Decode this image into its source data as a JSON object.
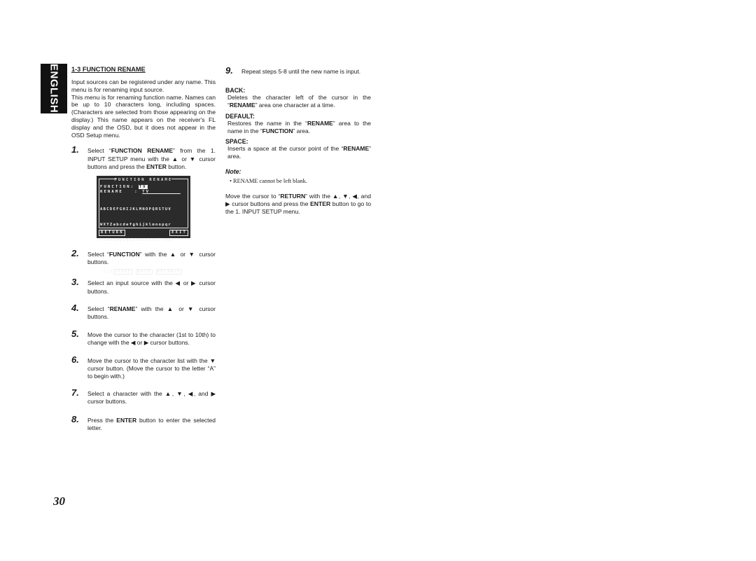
{
  "language_tab": "ENGLISH",
  "section": {
    "title": "1-3  FUNCTION RENAME",
    "intro": [
      "Input sources can be registered under any name. This menu is for renaming input source.",
      "This menu is for renaming function name. Names can be up to 10 characters long, including spaces. (Characters are selected from those appearing on the display.) This name appears on the receiver's FL display and the OSD, but it does not appear in the OSD Setup menu."
    ]
  },
  "steps": [
    {
      "num": "1.",
      "pre": "Select “",
      "bold": "FUNCTION RENAME",
      "post": "” from the 1. INPUT SETUP menu with the ▲ or ▼ cursor buttons and press the ",
      "bold2": "ENTER",
      "post2": " button."
    },
    {
      "num": "2.",
      "pre": "Select “",
      "bold": "FUNCTION",
      "post": "” with the ▲ or ▼ cursor buttons.",
      "bold2": "",
      "post2": ""
    },
    {
      "num": "3.",
      "pre": "Select an input source with the ◀ or ▶ cursor buttons.",
      "bold": "",
      "post": "",
      "bold2": "",
      "post2": ""
    },
    {
      "num": "4.",
      "pre": "Select “",
      "bold": "RENAME",
      "post": "” with the ▲ or ▼ cursor buttons.",
      "bold2": "",
      "post2": ""
    },
    {
      "num": "5.",
      "pre": "Move the cursor to the character (1st to 10th) to change with the ◀ or ▶ cursor buttons.",
      "bold": "",
      "post": "",
      "bold2": "",
      "post2": ""
    },
    {
      "num": "6.",
      "pre": "Move the cursor to the character list with the ▼ cursor button. (Move the cursor to the letter “A” to begin with.)",
      "bold": "",
      "post": "",
      "bold2": "",
      "post2": ""
    },
    {
      "num": "7.",
      "pre": "Select a character with the ▲, ▼, ◀, and ▶ cursor buttons.",
      "bold": "",
      "post": "",
      "bold2": "",
      "post2": ""
    },
    {
      "num": "8.",
      "pre": "Press the ",
      "bold": "ENTER",
      "post": " button to enter the selected letter.",
      "bold2": "",
      "post2": ""
    },
    {
      "num": "9.",
      "pre": "Repeat steps 5-8 until the new name is input.",
      "bold": "",
      "post": "",
      "bold2": "",
      "post2": ""
    }
  ],
  "osd": {
    "title": "FUNCTION RENAME",
    "function_label": "FUNCTION:",
    "function_value": "TV",
    "rename_label": "RENAME   :",
    "rename_value": "TV________",
    "char_rows": [
      "ABCDEFGHIJKLMNOPQRSTUV",
      "WXYZabcdefghijklmnopqr",
      "stuvwxyz0123456789!\"#$",
      "%&'()*+,-./:;<=>?@[\\]^",
      "_{|}"
    ],
    "space_btn": "SPACE",
    "back_btn": "BACK",
    "default_btn": "DEFAULT",
    "return_btn": "RETURN",
    "exit_btn": "EXIT"
  },
  "definitions": [
    {
      "term": "BACK:",
      "pre": "Deletes the character left of the cursor in the “",
      "bold": "RENAME",
      "post": "” area one character at a time.",
      "bold2": "",
      "post2": ""
    },
    {
      "term": "DEFAULT:",
      "pre": "Restores the name in the “",
      "bold": "RENAME",
      "post": "” area to the name in the “",
      "bold2": "FUNCTION",
      "post2": "” area."
    },
    {
      "term": "SPACE:",
      "pre": "Inserts a space at the cursor point of the “",
      "bold": "RENAME",
      "post": "” area.",
      "bold2": "",
      "post2": ""
    }
  ],
  "note": {
    "title": "Note:",
    "items": [
      "• RENAME cannot be left blank."
    ]
  },
  "return_instruction": {
    "pre": "Move the cursor to “",
    "bold": "RETURN",
    "mid": "” with the ▲, ▼, ◀, and ▶ cursor buttons and press the ",
    "bold2": "ENTER",
    "post": " button to go to the 1. INPUT SETUP menu."
  },
  "page_number": "30"
}
